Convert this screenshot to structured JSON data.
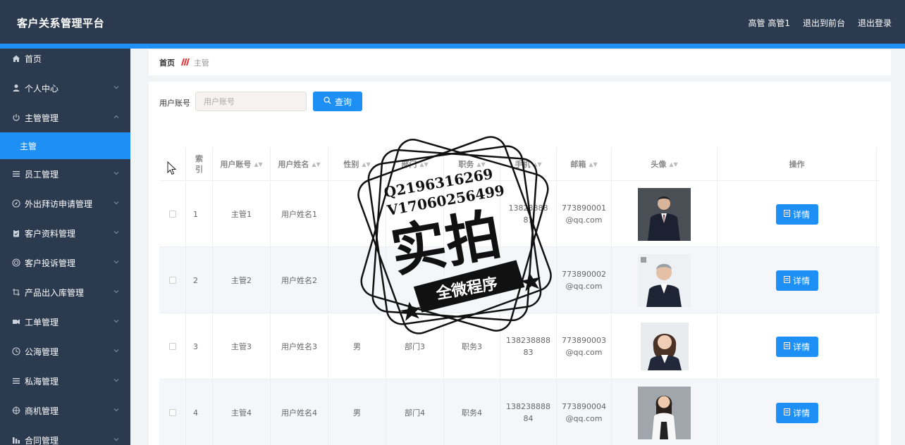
{
  "header": {
    "title": "客户关系管理平台",
    "user": "高管 高管1",
    "back_to_front": "退出到前台",
    "logout": "退出登录"
  },
  "sidebar": {
    "items": [
      {
        "label": "首页",
        "icon": "home-icon",
        "has_chevron": false
      },
      {
        "label": "个人中心",
        "icon": "user-icon",
        "has_chevron": true
      },
      {
        "label": "主管管理",
        "icon": "power-icon",
        "has_chevron": true
      },
      {
        "label": "主管",
        "icon": "",
        "has_chevron": false,
        "active": true
      },
      {
        "label": "员工管理",
        "icon": "list-icon",
        "has_chevron": true
      },
      {
        "label": "外出拜访申请管理",
        "icon": "compass-icon",
        "has_chevron": true
      },
      {
        "label": "客户资料管理",
        "icon": "clipboard-icon",
        "has_chevron": true
      },
      {
        "label": "客户投诉管理",
        "icon": "target-icon",
        "has_chevron": true
      },
      {
        "label": "产品出入库管理",
        "icon": "crop-icon",
        "has_chevron": true
      },
      {
        "label": "工单管理",
        "icon": "ticket-icon",
        "has_chevron": true
      },
      {
        "label": "公海管理",
        "icon": "clock-icon",
        "has_chevron": true
      },
      {
        "label": "私海管理",
        "icon": "list-icon",
        "has_chevron": true
      },
      {
        "label": "商机管理",
        "icon": "crosshair-icon",
        "has_chevron": true
      },
      {
        "label": "合同管理",
        "icon": "bar-chart-icon",
        "has_chevron": true
      }
    ]
  },
  "breadcrumb": {
    "home": "首页",
    "current": "主管"
  },
  "search": {
    "label": "用户账号",
    "placeholder": "用户账号",
    "button": "查询"
  },
  "table": {
    "columns": [
      "",
      "索\n引",
      "用户账号",
      "用户姓名",
      "性别",
      "部门",
      "职务",
      "手机",
      "邮箱",
      "头像",
      "操作"
    ],
    "rows": [
      {
        "index": "1",
        "account": "主管1",
        "name": "用户姓名1",
        "gender": "",
        "dept": "",
        "title": "",
        "phone_a": "13823888",
        "phone_b": "81",
        "email_a": "773890001",
        "email_b": "@qq.com",
        "detail": "详情"
      },
      {
        "index": "2",
        "account": "主管2",
        "name": "用户姓名2",
        "gender": "",
        "dept": "",
        "title": "",
        "phone_a": "",
        "phone_b": "",
        "email_a": "773890002",
        "email_b": "@qq.com",
        "detail": "详情"
      },
      {
        "index": "3",
        "account": "主管3",
        "name": "用户姓名3",
        "gender": "男",
        "dept": "部门3",
        "title": "职务3",
        "phone_a": "138238888",
        "phone_b": "83",
        "email_a": "773890003",
        "email_b": "@qq.com",
        "detail": "详情"
      },
      {
        "index": "4",
        "account": "主管4",
        "name": "用户姓名4",
        "gender": "男",
        "dept": "部门4",
        "title": "职务4",
        "phone_a": "138238888",
        "phone_b": "84",
        "email_a": "773890004",
        "email_b": "@qq.com",
        "detail": "详情"
      }
    ]
  },
  "stamp": {
    "line1": "Q2196316269",
    "line2": "V17060256499",
    "main": "实拍",
    "banner": "全微程序"
  },
  "colors": {
    "header_bg": "#2b3a4e",
    "accent": "#1e90f5",
    "breadcrumb_sep": "#e5383b"
  }
}
